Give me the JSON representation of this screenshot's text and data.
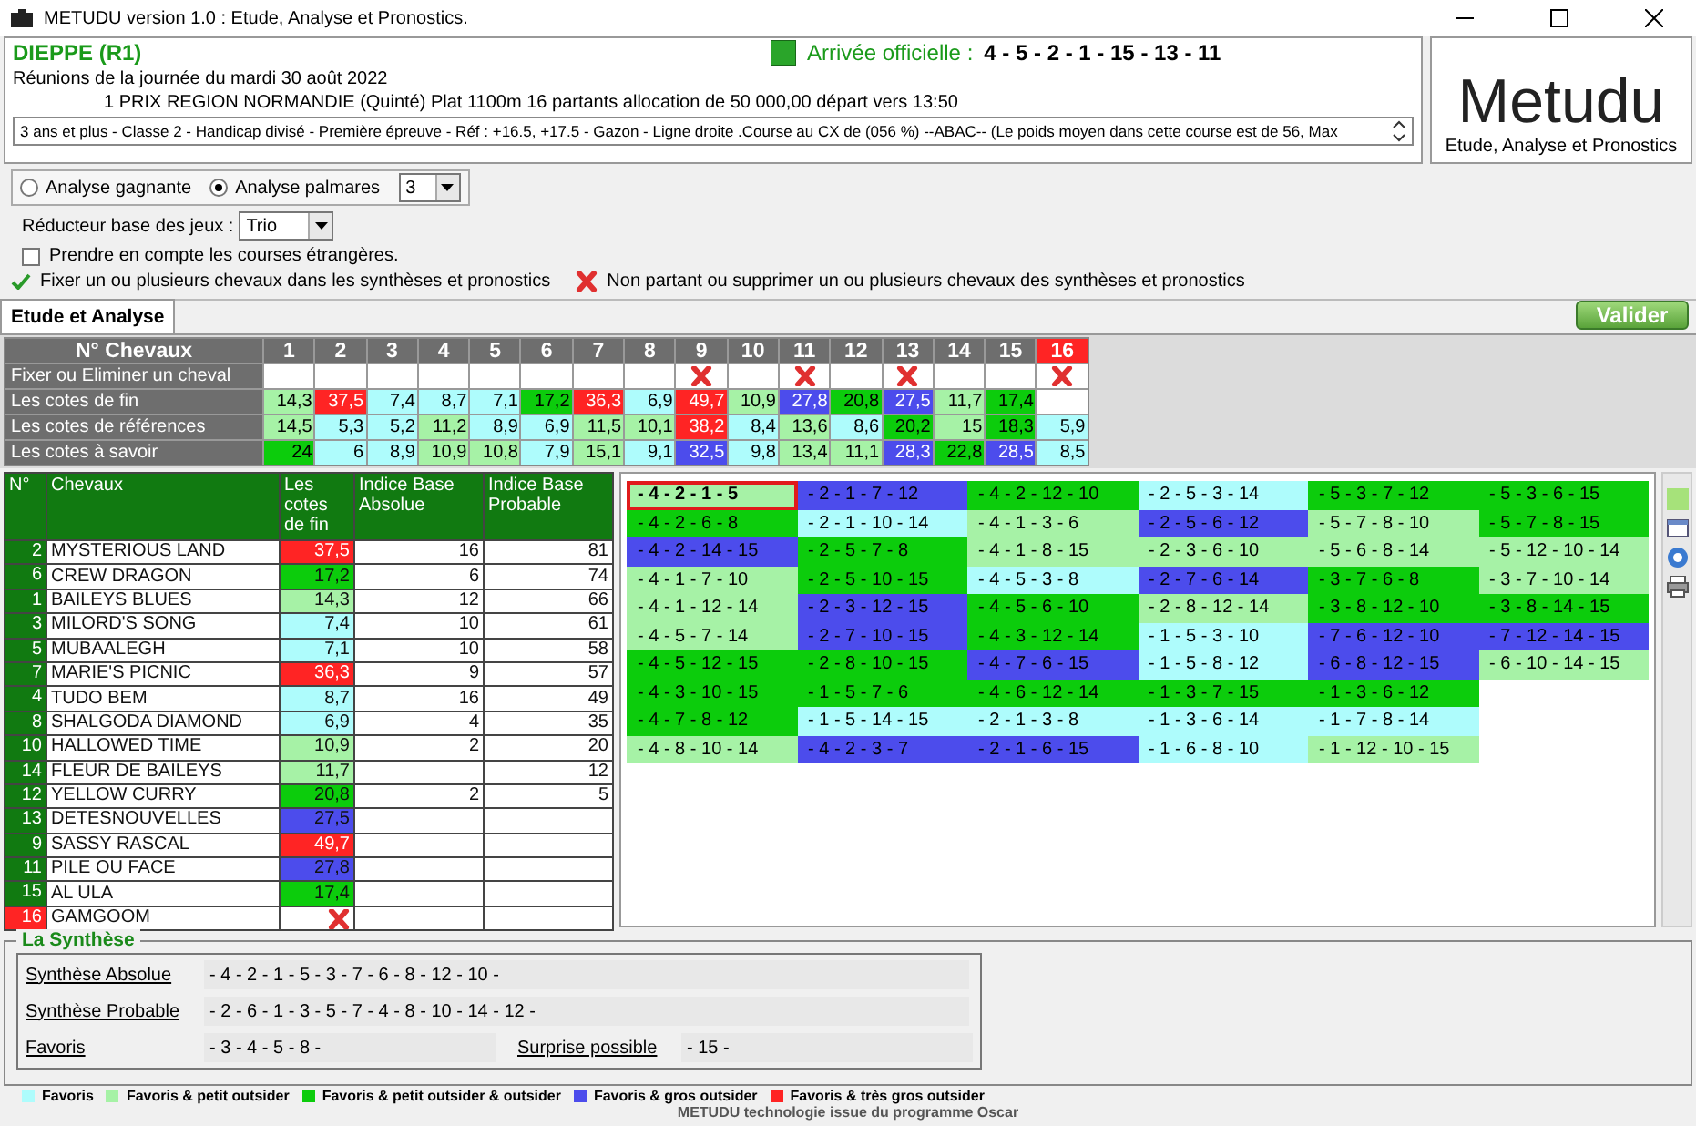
{
  "window": {
    "title": "METUDU version 1.0  : Etude, Analyse et Pronostics."
  },
  "race": {
    "venue": "DIEPPE (R1)",
    "arrival_label": "Arrivée officielle :",
    "arrival": "4 - 5 - 2 - 1 - 15 - 13 - 11",
    "date_line": "Réunions de la journée du mardi 30 août 2022",
    "race_line": "1 PRIX REGION NORMANDIE (Quinté) Plat 1100m 16 partants allocation de 50 000,00 départ vers 13:50",
    "conditions": "3 ans et plus - Classe 2 - Handicap divisé - Première épreuve - Réf : +16.5, +17.5 - Gazon - Ligne droite .Course au CX de (056 %)  --ABAC--  (Le poids moyen dans cette course est de 56, Max"
  },
  "logo": {
    "name": "Metudu",
    "tagline": "Etude, Analyse et Pronostics"
  },
  "analysis_modes": [
    {
      "label": "Analyse gagnante",
      "selected": false
    },
    {
      "label": "Analyse palmares",
      "selected": true
    }
  ],
  "palmares_count": "3",
  "reducer": {
    "label": "Réducteur base des jeux :",
    "value": "Trio"
  },
  "foreign_races": {
    "label": "Prendre en compte les courses étrangères.",
    "checked": false
  },
  "hint_fix": "Fixer un ou plusieurs chevaux dans les synthèses et pronostics",
  "hint_remove": "Non partant ou supprimer un ou plusieurs chevaux des synthèses et pronostics",
  "tabs": [
    {
      "label": "Etude et Analyse",
      "selected": true
    }
  ],
  "validate_button": "Valider",
  "grid": {
    "header": "N° Chevaux",
    "fix_label": "Fixer ou Eliminer un cheval",
    "row_labels": [
      "Les cotes de fin",
      "Les cotes de références",
      "Les cotes à savoir"
    ],
    "horses": [
      {
        "number": "1",
        "non_partant": false,
        "eliminated": false,
        "cotes": [
          {
            "value": "14,3",
            "color": "#a6f2a6"
          },
          {
            "value": "14,5",
            "color": "#a6f2a6"
          },
          {
            "value": "24",
            "color": "#0ccc0c"
          }
        ]
      },
      {
        "number": "2",
        "non_partant": false,
        "eliminated": false,
        "cotes": [
          {
            "value": "37,5",
            "color": "#ff2424"
          },
          {
            "value": "5,3",
            "color": "#aefcfc"
          },
          {
            "value": "6",
            "color": "#aefcfc"
          }
        ]
      },
      {
        "number": "3",
        "non_partant": false,
        "eliminated": false,
        "cotes": [
          {
            "value": "7,4",
            "color": "#aefcfc"
          },
          {
            "value": "5,2",
            "color": "#aefcfc"
          },
          {
            "value": "8,9",
            "color": "#aefcfc"
          }
        ]
      },
      {
        "number": "4",
        "non_partant": false,
        "eliminated": false,
        "cotes": [
          {
            "value": "8,7",
            "color": "#aefcfc"
          },
          {
            "value": "11,2",
            "color": "#a6f2a6"
          },
          {
            "value": "10,9",
            "color": "#a6f2a6"
          }
        ]
      },
      {
        "number": "5",
        "non_partant": false,
        "eliminated": false,
        "cotes": [
          {
            "value": "7,1",
            "color": "#aefcfc"
          },
          {
            "value": "8,9",
            "color": "#aefcfc"
          },
          {
            "value": "10,8",
            "color": "#a6f2a6"
          }
        ]
      },
      {
        "number": "6",
        "non_partant": false,
        "eliminated": false,
        "cotes": [
          {
            "value": "17,2",
            "color": "#0ccc0c"
          },
          {
            "value": "6,9",
            "color": "#aefcfc"
          },
          {
            "value": "7,9",
            "color": "#aefcfc"
          }
        ]
      },
      {
        "number": "7",
        "non_partant": false,
        "eliminated": false,
        "cotes": [
          {
            "value": "36,3",
            "color": "#ff2424"
          },
          {
            "value": "11,5",
            "color": "#a6f2a6"
          },
          {
            "value": "15,1",
            "color": "#a6f2a6"
          }
        ]
      },
      {
        "number": "8",
        "non_partant": false,
        "eliminated": false,
        "cotes": [
          {
            "value": "6,9",
            "color": "#aefcfc"
          },
          {
            "value": "10,1",
            "color": "#a6f2a6"
          },
          {
            "value": "9,1",
            "color": "#aefcfc"
          }
        ]
      },
      {
        "number": "9",
        "non_partant": false,
        "eliminated": true,
        "cotes": [
          {
            "value": "49,7",
            "color": "#ff2424"
          },
          {
            "value": "38,2",
            "color": "#ff2424"
          },
          {
            "value": "32,5",
            "color": "#4c4cec"
          }
        ]
      },
      {
        "number": "10",
        "non_partant": false,
        "eliminated": false,
        "cotes": [
          {
            "value": "10,9",
            "color": "#a6f2a6"
          },
          {
            "value": "8,4",
            "color": "#aefcfc"
          },
          {
            "value": "9,8",
            "color": "#aefcfc"
          }
        ]
      },
      {
        "number": "11",
        "non_partant": false,
        "eliminated": true,
        "cotes": [
          {
            "value": "27,8",
            "color": "#4c4cec"
          },
          {
            "value": "13,6",
            "color": "#a6f2a6"
          },
          {
            "value": "13,4",
            "color": "#a6f2a6"
          }
        ]
      },
      {
        "number": "12",
        "non_partant": false,
        "eliminated": false,
        "cotes": [
          {
            "value": "20,8",
            "color": "#0ccc0c"
          },
          {
            "value": "8,6",
            "color": "#aefcfc"
          },
          {
            "value": "11,1",
            "color": "#a6f2a6"
          }
        ]
      },
      {
        "number": "13",
        "non_partant": false,
        "eliminated": true,
        "cotes": [
          {
            "value": "27,5",
            "color": "#4c4cec"
          },
          {
            "value": "20,2",
            "color": "#0ccc0c"
          },
          {
            "value": "28,3",
            "color": "#4c4cec"
          }
        ]
      },
      {
        "number": "14",
        "non_partant": false,
        "eliminated": false,
        "cotes": [
          {
            "value": "11,7",
            "color": "#a6f2a6"
          },
          {
            "value": "15",
            "color": "#a6f2a6"
          },
          {
            "value": "22,8",
            "color": "#0ccc0c"
          }
        ]
      },
      {
        "number": "15",
        "non_partant": false,
        "eliminated": false,
        "cotes": [
          {
            "value": "17,4",
            "color": "#0ccc0c"
          },
          {
            "value": "18,3",
            "color": "#0ccc0c"
          },
          {
            "value": "28,5",
            "color": "#4c4cec"
          }
        ]
      },
      {
        "number": "16",
        "non_partant": true,
        "eliminated": true,
        "cotes": [
          {
            "color": "#ffffff"
          },
          {
            "value": "5,9",
            "color": "#aefcfc"
          },
          {
            "value": "8,5",
            "color": "#aefcfc"
          }
        ]
      }
    ]
  },
  "table": {
    "columns": [
      "N°",
      "Chevaux",
      "Les cotes de fin",
      "Indice Base Absolue",
      "Indice Base Probable"
    ],
    "rows": [
      {
        "number": "2",
        "name": "MYSTERIOUS LAND",
        "non_partant": false,
        "cote": "37,5",
        "color": "#ff2424",
        "absolue": "16",
        "probable": "81"
      },
      {
        "number": "6",
        "name": "CREW DRAGON",
        "non_partant": false,
        "cote": "17,2",
        "color": "#0ccc0c",
        "absolue": "6",
        "probable": "74"
      },
      {
        "number": "1",
        "name": "BAILEYS BLUES",
        "non_partant": false,
        "cote": "14,3",
        "color": "#a6f2a6",
        "absolue": "12",
        "probable": "66"
      },
      {
        "number": "3",
        "name": "MILORD'S SONG",
        "non_partant": false,
        "cote": "7,4",
        "color": "#aefcfc",
        "absolue": "10",
        "probable": "61"
      },
      {
        "number": "5",
        "name": "MUBAALEGH",
        "non_partant": false,
        "cote": "7,1",
        "color": "#aefcfc",
        "absolue": "10",
        "probable": "58"
      },
      {
        "number": "7",
        "name": "MARIE'S PICNIC",
        "non_partant": false,
        "cote": "36,3",
        "color": "#ff2424",
        "absolue": "9",
        "probable": "57"
      },
      {
        "number": "4",
        "name": "TUDO BEM",
        "non_partant": false,
        "cote": "8,7",
        "color": "#aefcfc",
        "absolue": "16",
        "probable": "49"
      },
      {
        "number": "8",
        "name": "SHALGODA DIAMOND",
        "non_partant": false,
        "cote": "6,9",
        "color": "#aefcfc",
        "absolue": "4",
        "probable": "35"
      },
      {
        "number": "10",
        "name": "HALLOWED TIME",
        "non_partant": false,
        "cote": "10,9",
        "color": "#a6f2a6",
        "absolue": "2",
        "probable": "20"
      },
      {
        "number": "14",
        "name": "FLEUR DE BAILEYS",
        "non_partant": false,
        "cote": "11,7",
        "color": "#a6f2a6",
        "probable": "12"
      },
      {
        "number": "12",
        "name": "YELLOW CURRY",
        "non_partant": false,
        "cote": "20,8",
        "color": "#0ccc0c",
        "absolue": "2",
        "probable": "5"
      },
      {
        "number": "13",
        "name": "DETESNOUVELLES",
        "non_partant": false,
        "cote": "27,5",
        "color": "#4c4cec"
      },
      {
        "number": "9",
        "name": "SASSY RASCAL",
        "non_partant": false,
        "cote": "49,7",
        "color": "#ff2424"
      },
      {
        "number": "11",
        "name": "PILE OU FACE",
        "non_partant": false,
        "cote": "27,8",
        "color": "#4c4cec"
      },
      {
        "number": "15",
        "name": "AL ULA",
        "non_partant": false,
        "cote": "17,4",
        "color": "#0ccc0c"
      },
      {
        "number": "16",
        "name": "GAMGOOM",
        "non_partant": true,
        "color": "#ffffff"
      }
    ]
  },
  "combinations": [
    {
      "cells": [
        {
          "text": "- 4 - 2 - 1 - 5",
          "color": "#a6f2a6",
          "selected": true
        },
        {
          "text": "- 2 - 1 - 7 - 12",
          "color": "#4c4cec",
          "selected": false
        },
        {
          "text": "- 4 - 2 - 12 - 10",
          "color": "#0ccc0c",
          "selected": false
        },
        {
          "text": "- 2 - 5 - 3 - 14",
          "color": "#aefcfc",
          "selected": false
        },
        {
          "text": "- 5 - 3 - 7 - 12",
          "color": "#0ccc0c",
          "selected": false
        },
        {
          "text": "- 5 - 3 - 6 - 15",
          "color": "#0ccc0c",
          "selected": false
        }
      ]
    },
    {
      "cells": [
        {
          "text": "- 4 - 2 - 6 - 8",
          "color": "#0ccc0c",
          "selected": false
        },
        {
          "text": "- 2 - 1 - 10 - 14",
          "color": "#aefcfc",
          "selected": false
        },
        {
          "text": "- 4 - 1 - 3 - 6",
          "color": "#a6f2a6",
          "selected": false
        },
        {
          "text": "- 2 - 5 - 6 - 12",
          "color": "#4c4cec",
          "selected": false
        },
        {
          "text": "- 5 - 7 - 8 - 10",
          "color": "#a6f2a6",
          "selected": false
        },
        {
          "text": "- 5 - 7 - 8 - 15",
          "color": "#0ccc0c",
          "selected": false
        }
      ]
    },
    {
      "cells": [
        {
          "text": "- 4 - 2 - 14 - 15",
          "color": "#4c4cec",
          "selected": false
        },
        {
          "text": "- 2 - 5 - 7 - 8",
          "color": "#0ccc0c",
          "selected": false
        },
        {
          "text": "- 4 - 1 - 8 - 15",
          "color": "#a6f2a6",
          "selected": false
        },
        {
          "text": "- 2 - 3 - 6 - 10",
          "color": "#a6f2a6",
          "selected": false
        },
        {
          "text": "- 5 - 6 - 8 - 14",
          "color": "#a6f2a6",
          "selected": false
        },
        {
          "text": "- 5 - 12 - 10 - 14",
          "color": "#a6f2a6",
          "selected": false
        }
      ]
    },
    {
      "cells": [
        {
          "text": "- 4 - 1 - 7 - 10",
          "color": "#a6f2a6",
          "selected": false
        },
        {
          "text": "- 2 - 5 - 10 - 15",
          "color": "#0ccc0c",
          "selected": false
        },
        {
          "text": "- 4 - 5 - 3 - 8",
          "color": "#aefcfc",
          "selected": false
        },
        {
          "text": "- 2 - 7 - 6 - 14",
          "color": "#4c4cec",
          "selected": false
        },
        {
          "text": "- 3 - 7 - 6 - 8",
          "color": "#0ccc0c",
          "selected": false
        },
        {
          "text": "- 3 - 7 - 10 - 14",
          "color": "#a6f2a6",
          "selected": false
        }
      ]
    },
    {
      "cells": [
        {
          "text": "- 4 - 1 - 12 - 14",
          "color": "#a6f2a6",
          "selected": false
        },
        {
          "text": "- 2 - 3 - 12 - 15",
          "color": "#4c4cec",
          "selected": false
        },
        {
          "text": "- 4 - 5 - 6 - 10",
          "color": "#0ccc0c",
          "selected": false
        },
        {
          "text": "- 2 - 8 - 12 - 14",
          "color": "#a6f2a6",
          "selected": false
        },
        {
          "text": "- 3 - 8 - 12 - 10",
          "color": "#0ccc0c",
          "selected": false
        },
        {
          "text": "- 3 - 8 - 14 - 15",
          "color": "#0ccc0c",
          "selected": false
        }
      ]
    },
    {
      "cells": [
        {
          "text": "- 4 - 5 - 7 - 14",
          "color": "#a6f2a6",
          "selected": false
        },
        {
          "text": "- 2 - 7 - 10 - 15",
          "color": "#4c4cec",
          "selected": false
        },
        {
          "text": "- 4 - 3 - 12 - 14",
          "color": "#0ccc0c",
          "selected": false
        },
        {
          "text": "- 1 - 5 - 3 - 10",
          "color": "#aefcfc",
          "selected": false
        },
        {
          "text": "- 7 - 6 - 12 - 10",
          "color": "#4c4cec",
          "selected": false
        },
        {
          "text": "- 7 - 12 - 14 - 15",
          "color": "#4c4cec",
          "selected": false
        }
      ]
    },
    {
      "cells": [
        {
          "text": "- 4 - 5 - 12 - 15",
          "color": "#0ccc0c",
          "selected": false
        },
        {
          "text": "- 2 - 8 - 10 - 15",
          "color": "#0ccc0c",
          "selected": false
        },
        {
          "text": "- 4 - 7 - 6 - 15",
          "color": "#4c4cec",
          "selected": false
        },
        {
          "text": "- 1 - 5 - 8 - 12",
          "color": "#aefcfc",
          "selected": false
        },
        {
          "text": "- 6 - 8 - 12 - 15",
          "color": "#4c4cec",
          "selected": false
        },
        {
          "text": "- 6 - 10 - 14 - 15",
          "color": "#a6f2a6",
          "selected": false
        }
      ]
    },
    {
      "cells": [
        {
          "text": "- 4 - 3 - 10 - 15",
          "color": "#0ccc0c",
          "selected": false
        },
        {
          "text": "- 1 - 5 - 7 - 6",
          "color": "#0ccc0c",
          "selected": false
        },
        {
          "text": "- 4 - 6 - 12 - 14",
          "color": "#0ccc0c",
          "selected": false
        },
        {
          "text": "- 1 - 3 - 7 - 15",
          "color": "#0ccc0c",
          "selected": false
        },
        {
          "text": "- 1 - 3 - 6 - 12",
          "color": "#0ccc0c",
          "selected": false
        }
      ]
    },
    {
      "cells": [
        {
          "text": "- 4 - 7 - 8 - 12",
          "color": "#0ccc0c",
          "selected": false
        },
        {
          "text": "- 1 - 5 - 14 - 15",
          "color": "#aefcfc",
          "selected": false
        },
        {
          "text": "- 2 - 1 - 3 - 8",
          "color": "#aefcfc",
          "selected": false
        },
        {
          "text": "- 1 - 3 - 6 - 14",
          "color": "#aefcfc",
          "selected": false
        },
        {
          "text": "- 1 - 7 - 8 - 14",
          "color": "#aefcfc",
          "selected": false
        }
      ]
    },
    {
      "cells": [
        {
          "text": "- 4 - 8 - 10 - 14",
          "color": "#a6f2a6",
          "selected": false
        },
        {
          "text": "- 4 - 2 - 3 - 7",
          "color": "#4c4cec",
          "selected": false
        },
        {
          "text": "- 2 - 1 - 6 - 15",
          "color": "#4c4cec",
          "selected": false
        },
        {
          "text": "- 1 - 6 - 8 - 10",
          "color": "#aefcfc",
          "selected": false
        },
        {
          "text": "- 1 - 12 - 10 - 15",
          "color": "#a6f2a6",
          "selected": false
        }
      ]
    }
  ],
  "synthese": {
    "title": "La Synthèse",
    "rows": [
      {
        "label": "Synthèse Absolue",
        "value": "- 4 - 2 - 1 - 5 - 3 - 7 - 6 - 8 - 12 - 10 -"
      },
      {
        "label": "Synthèse Probable",
        "value": "- 2 - 6 - 1 - 3 - 5 - 7 - 4 - 8 - 10 - 14 - 12 -"
      }
    ],
    "favoris": {
      "label": "Favoris",
      "value": "- 3 - 4 - 5 - 8 -"
    },
    "surprise": {
      "label": "Surprise possible",
      "value": "- 15 -"
    }
  },
  "legend": [
    {
      "label": "Favoris",
      "color": "#aefcfc"
    },
    {
      "label": "Favoris & petit outsider",
      "color": "#a6f2a6"
    },
    {
      "label": "Favoris & petit outsider & outsider",
      "color": "#0ccc0c"
    },
    {
      "label": "Favoris & gros outsider",
      "color": "#4c4cec"
    },
    {
      "label": "Favoris & très gros outsider",
      "color": "#ff2424"
    }
  ],
  "footer": "METUDU technologie issue du programme Oscar"
}
